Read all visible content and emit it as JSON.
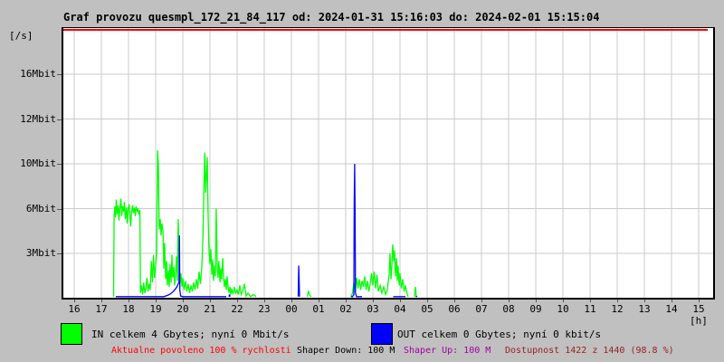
{
  "window": {
    "background": "#c0c0c0"
  },
  "title": "Graf provozu quesmpl_172_21_84_117 od: 2024-01-31 15:16:03 do: 2024-02-01 15:15:04",
  "y_axis": {
    "unit_label": "[/s]",
    "ticks": [
      {
        "label": "16Mbit",
        "value": 16
      },
      {
        "label": "12Mbit",
        "value": 12
      },
      {
        "label": "10Mbit",
        "value": 10
      },
      {
        "label": "6Mbit",
        "value": 6
      },
      {
        "label": "3Mbit",
        "value": 3
      }
    ]
  },
  "x_axis": {
    "labels": [
      "16",
      "17",
      "18",
      "19",
      "20",
      "21",
      "22",
      "23",
      "00",
      "01",
      "02",
      "03",
      "04",
      "05",
      "06",
      "07",
      "08",
      "09",
      "10",
      "11",
      "12",
      "13",
      "14",
      "15"
    ],
    "unit_label": "[h]"
  },
  "legend": {
    "in": {
      "swatch_color": "#00ff00",
      "label": "IN celkem 4 Gbytes; nyní 0 Mbit/s"
    },
    "out": {
      "swatch_color": "#0000ff",
      "label": "OUT celkem 0 Gbytes; nyní 0 kbit/s"
    }
  },
  "status_bar": {
    "items": [
      {
        "id": "allowed-speed",
        "text": "Aktualne povoleno 100 % rychlosti",
        "color": "#ff0000"
      },
      {
        "id": "shaper-down",
        "text": "Shaper Down: 100 M",
        "color": "#000000"
      },
      {
        "id": "shaper-up",
        "text": "Shaper Up: 100 M",
        "color": "#a000a0"
      },
      {
        "id": "availability",
        "text": "Dostupnost 1422 z 1440 (98.8 %)",
        "color": "#992020"
      }
    ]
  },
  "chart_data": {
    "type": "line",
    "title": "Graf provozu quesmpl_172_21_84_117 od: 2024-01-31 15:16:03 do: 2024-02-01 15:15:04",
    "xlabel": "[h]",
    "ylabel": "[/s]",
    "x_unit": "hours after 16:00 (axis runs 16h .. 15h next day)",
    "y_unit": "Mbit/s",
    "ylim": [
      0,
      17
    ],
    "grid": true,
    "top_limit_line_color": "#ff0000",
    "y_tick_values": [
      16,
      12,
      10,
      6,
      3
    ],
    "legend_position": "bottom",
    "series": [
      {
        "name": "IN",
        "color": "#00ff00",
        "segments": [
          [
            [
              1.45,
              0
            ],
            [
              1.47,
              5.5
            ],
            [
              1.5,
              6.2
            ],
            [
              1.52,
              5.4
            ],
            [
              1.55,
              6.8
            ],
            [
              1.58,
              5.6
            ],
            [
              1.62,
              6.3
            ],
            [
              1.65,
              5.2
            ],
            [
              1.68,
              6.0
            ],
            [
              1.72,
              6.9
            ],
            [
              1.75,
              5.5
            ],
            [
              1.78,
              6.2
            ],
            [
              1.82,
              5.8
            ],
            [
              1.85,
              6.6
            ],
            [
              1.88,
              5.3
            ],
            [
              1.92,
              6.1
            ],
            [
              1.95,
              5.0
            ],
            [
              1.98,
              5.9
            ],
            [
              2.02,
              6.4
            ],
            [
              2.05,
              5.6
            ],
            [
              2.08,
              4.8
            ],
            [
              2.12,
              5.9
            ],
            [
              2.15,
              6.3
            ],
            [
              2.18,
              5.7
            ],
            [
              2.22,
              6.1
            ],
            [
              2.25,
              5.5
            ],
            [
              2.28,
              6.2
            ],
            [
              2.32,
              5.8
            ],
            [
              2.35,
              6.0
            ],
            [
              2.38,
              5.6
            ],
            [
              2.42,
              5.9
            ],
            [
              2.44,
              0.4
            ],
            [
              2.48,
              0.9
            ],
            [
              2.52,
              0.3
            ],
            [
              2.56,
              1.1
            ],
            [
              2.6,
              0.4
            ],
            [
              2.64,
              0.7
            ],
            [
              2.68,
              1.4
            ],
            [
              2.72,
              0.5
            ],
            [
              2.76,
              1.0
            ],
            [
              2.8,
              0.6
            ],
            [
              2.84,
              2.5
            ],
            [
              2.88,
              1.1
            ],
            [
              2.92,
              2.9
            ],
            [
              2.96,
              1.4
            ],
            [
              3.0,
              2.2
            ],
            [
              3.04,
              3.1
            ],
            [
              3.07,
              10.6
            ],
            [
              3.1,
              9.8
            ],
            [
              3.13,
              4.6
            ],
            [
              3.17,
              5.3
            ],
            [
              3.2,
              4.2
            ],
            [
              3.23,
              5.0
            ],
            [
              3.27,
              4.5
            ],
            [
              3.3,
              2.0
            ],
            [
              3.33,
              3.7
            ],
            [
              3.37,
              1.3
            ],
            [
              3.4,
              2.5
            ],
            [
              3.43,
              0.9
            ],
            [
              3.47,
              1.9
            ],
            [
              3.5,
              0.8
            ],
            [
              3.53,
              2.3
            ],
            [
              3.57,
              1.1
            ],
            [
              3.6,
              2.9
            ],
            [
              3.63,
              1.4
            ],
            [
              3.67,
              2.1
            ],
            [
              3.7,
              0.9
            ],
            [
              3.73,
              1.6
            ],
            [
              3.77,
              2.8
            ],
            [
              3.8,
              1.2
            ],
            [
              3.83,
              5.3
            ],
            [
              3.87,
              2.1
            ],
            [
              3.9,
              1.0
            ],
            [
              3.93,
              1.7
            ],
            [
              3.97,
              0.8
            ],
            [
              4.0,
              1.4
            ],
            [
              4.05,
              0.6
            ],
            [
              4.1,
              1.2
            ],
            [
              4.15,
              0.5
            ],
            [
              4.2,
              1.0
            ],
            [
              4.25,
              0.4
            ],
            [
              4.3,
              0.9
            ],
            [
              4.35,
              0.5
            ],
            [
              4.4,
              1.1
            ],
            [
              4.45,
              0.6
            ],
            [
              4.5,
              1.3
            ],
            [
              4.55,
              0.7
            ],
            [
              4.6,
              1.8
            ],
            [
              4.65,
              1.0
            ],
            [
              4.7,
              2.1
            ],
            [
              4.74,
              4.0
            ],
            [
              4.78,
              8.2
            ],
            [
              4.81,
              10.5
            ],
            [
              4.84,
              7.4
            ],
            [
              4.87,
              9.0
            ],
            [
              4.9,
              10.3
            ],
            [
              4.93,
              5.8
            ],
            [
              4.96,
              3.4
            ],
            [
              5.0,
              2.3
            ],
            [
              5.03,
              3.3
            ],
            [
              5.07,
              1.6
            ],
            [
              5.1,
              2.6
            ],
            [
              5.13,
              1.2
            ],
            [
              5.17,
              2.2
            ],
            [
              5.2,
              1.5
            ],
            [
              5.23,
              6.0
            ],
            [
              5.27,
              2.0
            ],
            [
              5.3,
              1.4
            ],
            [
              5.33,
              2.5
            ],
            [
              5.37,
              1.1
            ],
            [
              5.4,
              2.0
            ],
            [
              5.43,
              1.3
            ],
            [
              5.47,
              2.7
            ],
            [
              5.5,
              1.5
            ],
            [
              5.53,
              0.8
            ],
            [
              5.57,
              1.3
            ],
            [
              5.6,
              0.6
            ],
            [
              5.63,
              1.5
            ],
            [
              5.67,
              0.8
            ],
            [
              5.7,
              0.4
            ],
            [
              5.73,
              0.8
            ],
            [
              5.77,
              0.3
            ],
            [
              5.8,
              0.7
            ],
            [
              5.85,
              0.3
            ],
            [
              5.9,
              0.8
            ],
            [
              5.95,
              0.4
            ],
            [
              6.0,
              0.6
            ],
            [
              6.05,
              0.3
            ],
            [
              6.1,
              0.9
            ],
            [
              6.15,
              0.3
            ],
            [
              6.2,
              0.5
            ],
            [
              6.27,
              1.0
            ],
            [
              6.33,
              0.2
            ],
            [
              6.4,
              0.4
            ],
            [
              6.5,
              0.15
            ],
            [
              6.6,
              0.3
            ],
            [
              6.7,
              0
            ]
          ],
          [
            [
              8.58,
              0
            ],
            [
              8.63,
              0.5
            ],
            [
              8.68,
              0.25
            ],
            [
              8.73,
              0
            ]
          ],
          [
            [
              10.18,
              0
            ],
            [
              10.25,
              0.4
            ],
            [
              10.3,
              1.1
            ],
            [
              10.35,
              0.5
            ],
            [
              10.4,
              1.4
            ],
            [
              10.45,
              0.7
            ],
            [
              10.5,
              1.3
            ],
            [
              10.55,
              0.6
            ],
            [
              10.6,
              1.2
            ],
            [
              10.65,
              0.8
            ],
            [
              10.7,
              1.5
            ],
            [
              10.75,
              0.6
            ],
            [
              10.8,
              1.2
            ],
            [
              10.85,
              0.5
            ],
            [
              10.9,
              1.0
            ],
            [
              10.95,
              1.7
            ],
            [
              11.0,
              0.9
            ],
            [
              11.05,
              1.8
            ],
            [
              11.1,
              0.7
            ],
            [
              11.15,
              1.6
            ],
            [
              11.2,
              0.5
            ],
            [
              11.27,
              0.9
            ],
            [
              11.33,
              0.4
            ],
            [
              11.4,
              0.8
            ],
            [
              11.47,
              0.3
            ],
            [
              11.53,
              0.6
            ],
            [
              11.6,
              1.6
            ],
            [
              11.63,
              3.0
            ],
            [
              11.67,
              1.3
            ],
            [
              11.7,
              2.2
            ],
            [
              11.73,
              3.6
            ],
            [
              11.77,
              2.5
            ],
            [
              11.8,
              3.2
            ],
            [
              11.83,
              1.5
            ],
            [
              11.87,
              2.7
            ],
            [
              11.9,
              1.2
            ],
            [
              11.93,
              2.2
            ],
            [
              11.97,
              0.9
            ],
            [
              12.0,
              1.7
            ],
            [
              12.05,
              0.7
            ],
            [
              12.1,
              1.3
            ],
            [
              12.15,
              0.5
            ],
            [
              12.2,
              0.9
            ],
            [
              12.25,
              0.4
            ],
            [
              12.3,
              0
            ]
          ],
          [
            [
              12.53,
              0
            ],
            [
              12.57,
              0.8
            ],
            [
              12.6,
              0
            ]
          ]
        ]
      },
      {
        "name": "OUT",
        "color": "#0000ff",
        "segments": [
          [
            [
              1.53,
              0.07
            ],
            [
              2.4,
              0.08
            ],
            [
              2.45,
              0.05
            ],
            [
              3.0,
              0.07
            ],
            [
              3.3,
              0.1
            ],
            [
              3.45,
              0.25
            ],
            [
              3.55,
              0.35
            ],
            [
              3.65,
              0.5
            ],
            [
              3.72,
              0.65
            ],
            [
              3.78,
              0.8
            ],
            [
              3.83,
              1.0
            ],
            [
              3.86,
              1.1
            ],
            [
              3.875,
              4.2
            ],
            [
              3.89,
              0.6
            ],
            [
              3.92,
              0.2
            ],
            [
              4.0,
              0.12
            ],
            [
              4.3,
              0.08
            ],
            [
              4.6,
              0.1
            ],
            [
              4.85,
              0.15
            ],
            [
              4.9,
              0.08
            ],
            [
              5.1,
              0.06
            ],
            [
              5.2,
              0.1
            ],
            [
              5.3,
              0.05
            ],
            [
              5.5,
              0.07
            ],
            [
              5.6,
              0
            ]
          ],
          [
            [
              5.7,
              0
            ],
            [
              5.72,
              0.3
            ],
            [
              5.74,
              0
            ]
          ],
          [
            [
              8.25,
              0
            ],
            [
              8.27,
              2.2
            ],
            [
              8.3,
              0
            ]
          ],
          [
            [
              10.2,
              0
            ],
            [
              10.25,
              0.12
            ],
            [
              10.3,
              0.3
            ],
            [
              10.315,
              6.6
            ],
            [
              10.33,
              10.0
            ],
            [
              10.345,
              5.2
            ],
            [
              10.36,
              0.4
            ],
            [
              10.4,
              0.15
            ],
            [
              10.5,
              0.1
            ],
            [
              10.6,
              0
            ]
          ],
          [
            [
              11.75,
              0
            ],
            [
              11.8,
              0.07
            ],
            [
              11.9,
              0
            ],
            [
              12.0,
              0.06
            ],
            [
              12.2,
              0
            ]
          ],
          [
            [
              12.58,
              0
            ],
            [
              12.6,
              0.18
            ],
            [
              12.63,
              0
            ]
          ]
        ]
      }
    ]
  }
}
